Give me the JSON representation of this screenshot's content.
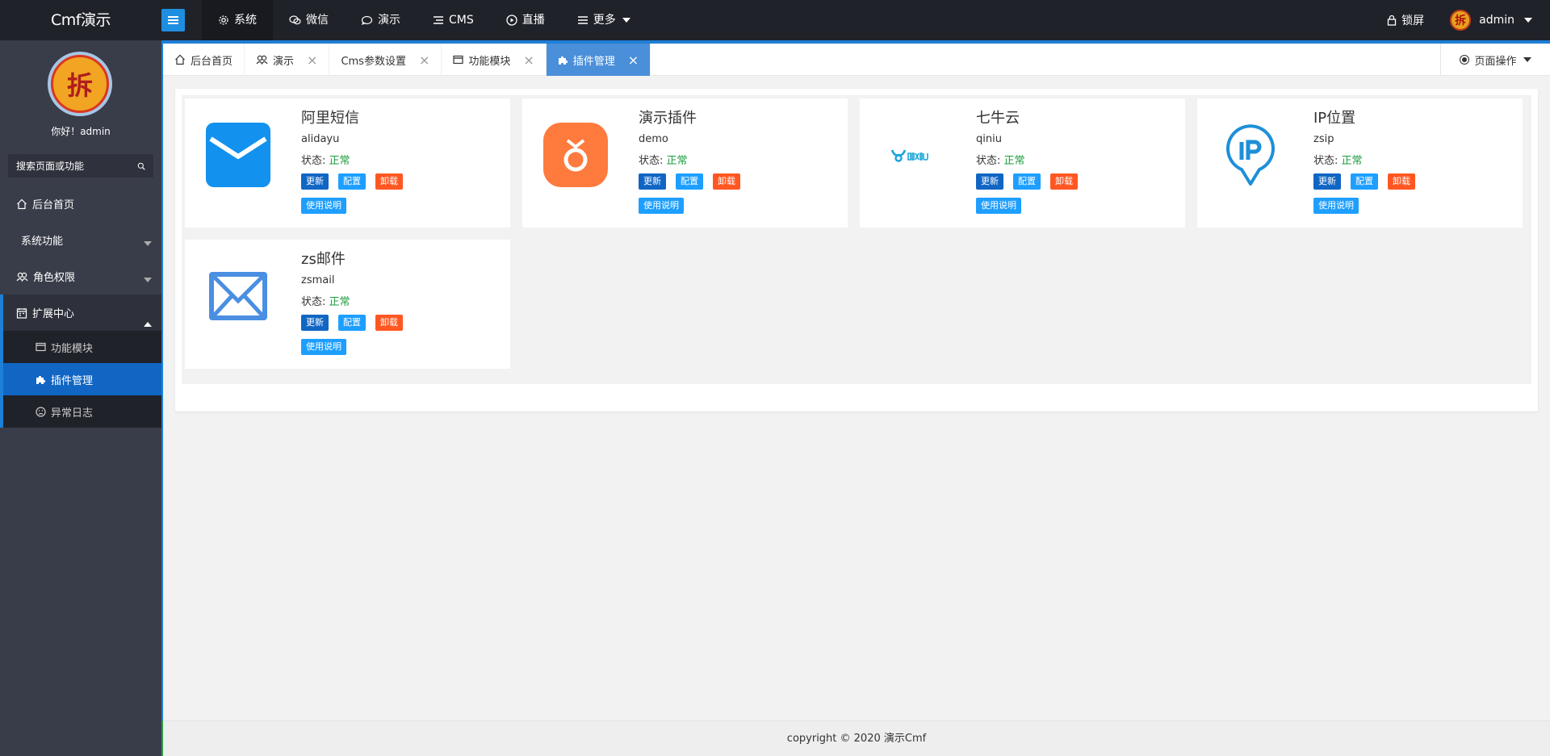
{
  "header": {
    "logo": "Cmf演示",
    "nav": [
      {
        "label": "系统",
        "icon": "gear-icon",
        "active": true
      },
      {
        "label": "微信",
        "icon": "wechat-icon"
      },
      {
        "label": "演示",
        "icon": "demo-icon"
      },
      {
        "label": "CMS",
        "icon": "list-icon"
      },
      {
        "label": "直播",
        "icon": "play-icon"
      },
      {
        "label": "更多",
        "icon": "menu-icon",
        "dropdown": true
      }
    ],
    "lock_label": "锁屏",
    "avatar_glyph": "拆",
    "user_label": "admin"
  },
  "sidebar": {
    "avatar_glyph": "拆",
    "greeting": "你好！admin",
    "search_placeholder": "搜索页面或功能",
    "items": [
      {
        "label": "后台首页",
        "icon": "home-icon"
      },
      {
        "label": "系统功能"
      },
      {
        "label": "角色权限",
        "icon": "users-icon"
      },
      {
        "label": "扩展中心",
        "icon": "calendar-icon",
        "open": true
      }
    ],
    "sub_items": [
      {
        "label": "功能模块",
        "icon": "window-icon"
      },
      {
        "label": "插件管理",
        "icon": "puzzle-icon",
        "active": true
      },
      {
        "label": "异常日志",
        "icon": "frown-icon"
      }
    ]
  },
  "tabs": [
    {
      "label": "后台首页",
      "icon": "home-icon",
      "closable": false
    },
    {
      "label": "演示",
      "icon": "users-icon",
      "closable": true
    },
    {
      "label": "Cms参数设置",
      "closable": true
    },
    {
      "label": "功能模块",
      "icon": "window-icon",
      "closable": true
    },
    {
      "label": "插件管理",
      "icon": "puzzle-icon",
      "closable": true,
      "active": true
    }
  ],
  "page_ops_label": "页面操作",
  "status_prefix": "状态: ",
  "buttons": {
    "update": "更新",
    "config": "配置",
    "uninstall": "卸载",
    "docs": "使用说明"
  },
  "plugins": [
    {
      "title": "阿里短信",
      "name": "alidayu",
      "status": "正常",
      "icon": "envelope-icon"
    },
    {
      "title": "演示插件",
      "name": "demo",
      "status": "正常",
      "icon": "medal-icon"
    },
    {
      "title": "七牛云",
      "name": "qiniu",
      "status": "正常",
      "icon": "qiniu-logo-icon"
    },
    {
      "title": "IP位置",
      "name": "zsip",
      "status": "正常",
      "icon": "ip-pin-icon"
    },
    {
      "title": "zs邮件",
      "name": "zsmail",
      "status": "正常",
      "icon": "mail-outline-icon"
    }
  ],
  "footer": "copyright © 2020 演示Cmf",
  "colors": {
    "header_bg": "#20222a",
    "sidebar_bg": "#393d49",
    "accent": "#1e7fd6",
    "active_tab": "#4a8fd9",
    "update_btn": "#1166c4",
    "config_btn": "#1e9fff",
    "uninstall_btn": "#ff5722",
    "status_ok": "#1c9e3e"
  }
}
